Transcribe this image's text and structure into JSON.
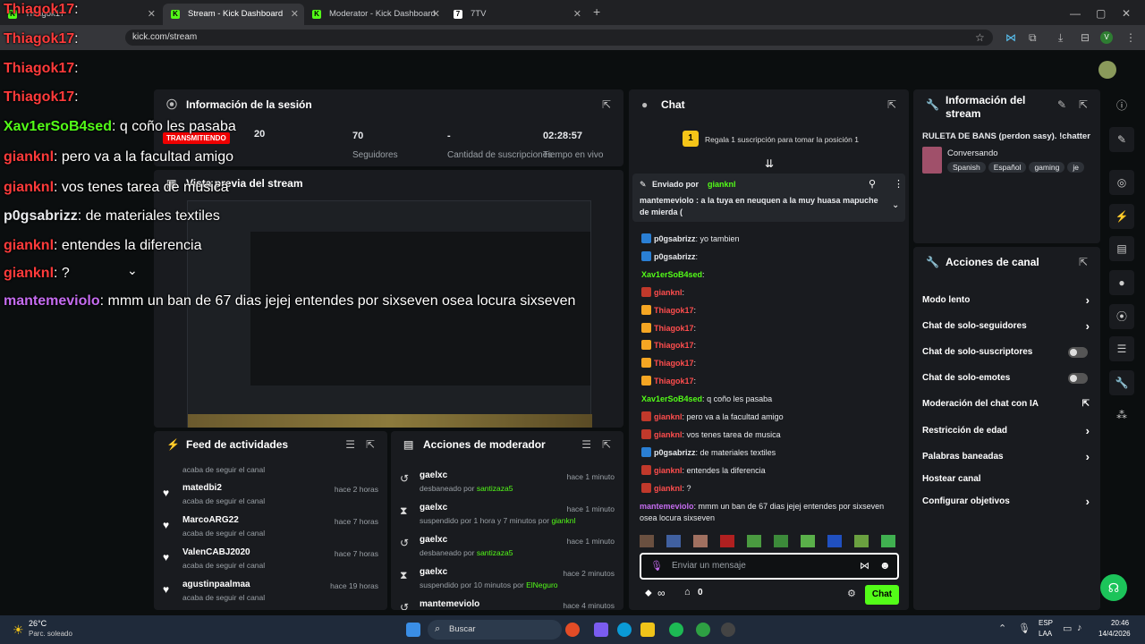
{
  "browser": {
    "tabs": [
      {
        "label": "Thiagok17",
        "active": false
      },
      {
        "label": "Stream - Kick Dashboard",
        "active": true
      },
      {
        "label": "Moderator - Kick Dashboard",
        "active": false
      },
      {
        "label": "7TV",
        "active": false
      }
    ],
    "url": "kick.com/stream"
  },
  "session": {
    "title": "Información de la sesión",
    "status": "TRANSMITIENDO",
    "viewers": "20",
    "followers_value": "70",
    "followers_label": "Seguidores",
    "subs_value": "-",
    "subs_label": "Cantidad de suscripciones",
    "live_value": "02:28:57",
    "live_label": "Tiempo en vivo"
  },
  "preview": {
    "title": "Vista previa del stream"
  },
  "feed": {
    "title": "Feed de actividades",
    "items": [
      {
        "name": "",
        "sub": "acaba de seguir el canal",
        "time": ""
      },
      {
        "name": "matedbi2",
        "sub": "acaba de seguir el canal",
        "time": "hace 2 horas"
      },
      {
        "name": "MarcoARG22",
        "sub": "acaba de seguir el canal",
        "time": "hace 7 horas"
      },
      {
        "name": "ValenCABJ2020",
        "sub": "acaba de seguir el canal",
        "time": "hace 7 horas"
      },
      {
        "name": "agustinpaalmaa",
        "sub": "acaba de seguir el canal",
        "time": "hace 19 horas"
      }
    ]
  },
  "modactions": {
    "title": "Acciones de moderador",
    "items": [
      {
        "name": "gaelxc",
        "pre": "desbaneado por",
        "by": "santizaza5",
        "time": "hace 1 minuto",
        "icon": "↺"
      },
      {
        "name": "gaelxc",
        "pre": "suspendido por 1 hora y 7 minutos por",
        "by": "gianknl",
        "time": "hace 1 minuto",
        "icon": "⧗"
      },
      {
        "name": "gaelxc",
        "pre": "desbaneado por",
        "by": "santizaza5",
        "time": "hace 1 minuto",
        "icon": "↺"
      },
      {
        "name": "gaelxc",
        "pre": "suspendido por 10 minutos por",
        "by": "ElNeguro",
        "time": "hace 2 minutos",
        "icon": "⧗"
      },
      {
        "name": "mantemeviolo",
        "pre": "",
        "by": "",
        "time": "hace 4 minutos",
        "icon": "↺"
      }
    ]
  },
  "chat": {
    "title": "Chat",
    "gift_prompt": "Regala 1 suscripción para tomar la posición 1",
    "gift_rank": "1",
    "pinned_by_label": "Enviado por",
    "pinned_by": "gianknl",
    "pinned_text": "mantemeviolo : a la tuya en neuquen a la muy huasa mapuche de mierda (",
    "lines": [
      {
        "user": "p0gsabrizz",
        "text": "yo tambien",
        "color": "#e8eaed",
        "badge": "blue"
      },
      {
        "user": "p0gsabrizz",
        "text": "",
        "color": "#e8eaed",
        "badge": "blue"
      },
      {
        "user": "Xav1erSoB4sed",
        "text": "",
        "color": "#53fc18",
        "badge": ""
      },
      {
        "user": "gianknl",
        "text": "",
        "color": "#ff4d4d",
        "badge": "red"
      },
      {
        "user": "Thiagok17",
        "text": "",
        "color": "#ff4d4d",
        "badge": "gold"
      },
      {
        "user": "Thiagok17",
        "text": "",
        "color": "#ff4d4d",
        "badge": "gold"
      },
      {
        "user": "Thiagok17",
        "text": "",
        "color": "#ff4d4d",
        "badge": "gold"
      },
      {
        "user": "Thiagok17",
        "text": "",
        "color": "#ff4d4d",
        "badge": "gold"
      },
      {
        "user": "Thiagok17",
        "text": "",
        "color": "#ff4d4d",
        "badge": "gold"
      },
      {
        "user": "Xav1erSoB4sed",
        "text": "q coño les pasaba",
        "color": "#53fc18",
        "badge": ""
      },
      {
        "user": "gianknl",
        "text": "pero      va a la facultad amigo",
        "color": "#ff4d4d",
        "badge": "red"
      },
      {
        "user": "gianknl",
        "text": "vos tenes tarea de musica",
        "color": "#ff4d4d",
        "badge": "red"
      },
      {
        "user": "p0gsabrizz",
        "text": "de materiales textiles",
        "color": "#e8eaed",
        "badge": "blue"
      },
      {
        "user": "gianknl",
        "text": "entendes la diferencia",
        "color": "#ff4d4d",
        "badge": "red"
      },
      {
        "user": "gianknl",
        "text": "?",
        "color": "#ff4d4d",
        "badge": "red"
      }
    ],
    "last_user": "mantemeviolo",
    "last_text": "mmm un ban de 67 dias jejej entendes por sixseven osea locura sixseven",
    "input_placeholder": "Enviar un mensaje",
    "points": "∞",
    "gifts": "0",
    "send_label": "Chat"
  },
  "streaminfo": {
    "title": "Información del stream",
    "stream_title": "RULETA DE BANS (perdon sasy). !chatter",
    "category": "Conversando",
    "tags": [
      "Spanish",
      "Español",
      "gaming",
      "je"
    ]
  },
  "channel": {
    "title": "Acciones de canal",
    "items": [
      {
        "label": "Modo lento",
        "kind": "chev"
      },
      {
        "label": "Chat de solo-seguidores",
        "kind": "chev"
      },
      {
        "label": "Chat de solo-suscriptores",
        "kind": "toggle"
      },
      {
        "label": "Chat de solo-emotes",
        "kind": "toggle"
      },
      {
        "label": "Moderación del chat con IA",
        "kind": "ext"
      },
      {
        "label": "Restricción de edad",
        "kind": "chev"
      },
      {
        "label": "Palabras baneadas",
        "kind": "chev"
      },
      {
        "label": "Hostear canal",
        "kind": "none"
      },
      {
        "label": "Configurar objetivos",
        "kind": "chev"
      }
    ]
  },
  "overlay": {
    "lines": [
      {
        "user": "Thiagok17",
        "text": ""
      },
      {
        "user": "Thiagok17",
        "text": ""
      },
      {
        "user": "Thiagok17",
        "text": ""
      },
      {
        "user": "Thiagok17",
        "text": ""
      },
      {
        "user": "Xav1erSoB4sed",
        "text": "q coño les pasaba"
      },
      {
        "user": "gianknl",
        "text": "pero       va a la facultad amigo"
      },
      {
        "user": "gianknl",
        "text": "vos tenes tarea de musica"
      },
      {
        "user": "p0gsabrizz",
        "text": "de materiales textiles"
      },
      {
        "user": "gianknl",
        "text": "entendes la diferencia"
      },
      {
        "user": "gianknl",
        "text": "?"
      },
      {
        "user": "mantemeviolo",
        "text": "mmm un ban de 67 dias jejej entendes por sixseven osea locura sixseven"
      }
    ]
  },
  "taskbar": {
    "weather_temp": "26°C",
    "weather_desc": "Parc. soleado",
    "search": "Buscar",
    "lang": "ESP",
    "lang2": "LAA",
    "time": "20:46",
    "date": "14/4/2026"
  },
  "colors": {
    "accent": "#53fc18",
    "panel": "#191b1f",
    "background": "#0b0e0f"
  }
}
